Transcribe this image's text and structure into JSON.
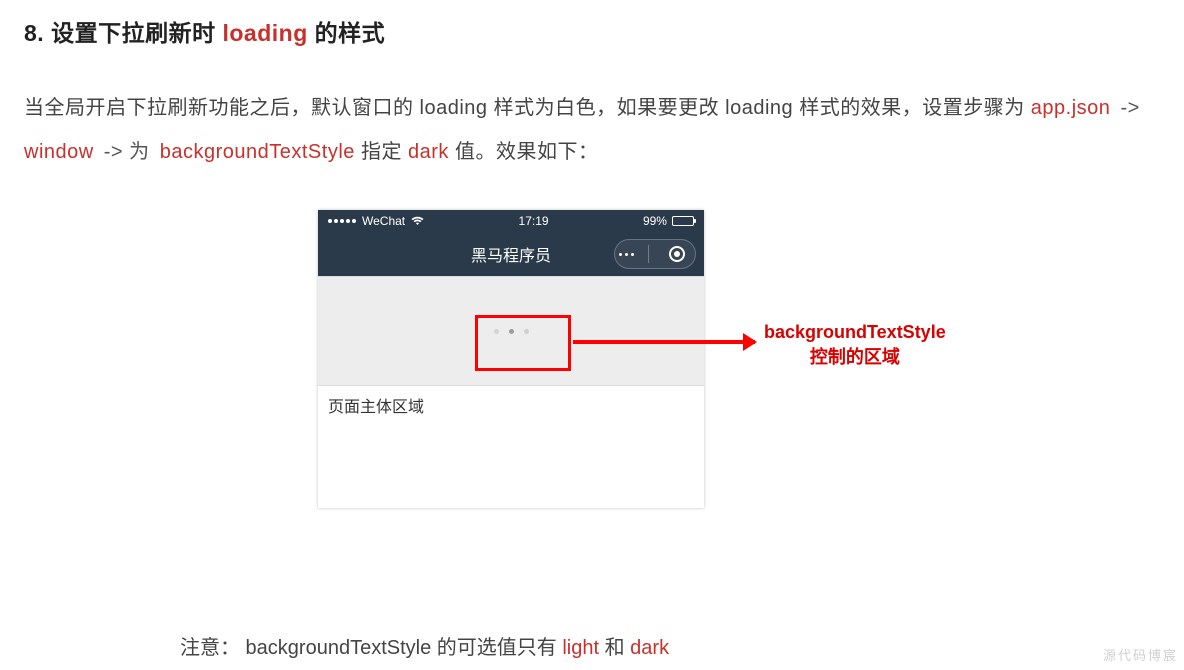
{
  "heading": {
    "number": "8. ",
    "prefix": "设置下拉刷新时 ",
    "loading_word": "loading",
    "suffix": " 的样式"
  },
  "paragraph": {
    "p1": "当全局开启下拉刷新功能之后，默认窗口的 loading 样式为白色，如果要更改 loading 样式的效果，设置步骤为 ",
    "step1": "app.json",
    "arrow": " -> ",
    "step2": "window",
    "arrow2": " -> 为 ",
    "step3": "backgroundTextStyle",
    "mid": " 指定 ",
    "step4": "dark",
    "end": " 值。效果如下："
  },
  "phone": {
    "carrier": "WeChat",
    "time": "17:19",
    "battery": "99%",
    "title": "黑马程序员",
    "content_text": "页面主体区域"
  },
  "callout": {
    "line1": "backgroundTextStyle",
    "line2": "控制的区域"
  },
  "note": {
    "prefix": "注意：  backgroundTextStyle 的可选值只有 ",
    "opt1": "light",
    "mid": " 和 ",
    "opt2": "dark"
  },
  "watermark": "源代码博宸"
}
